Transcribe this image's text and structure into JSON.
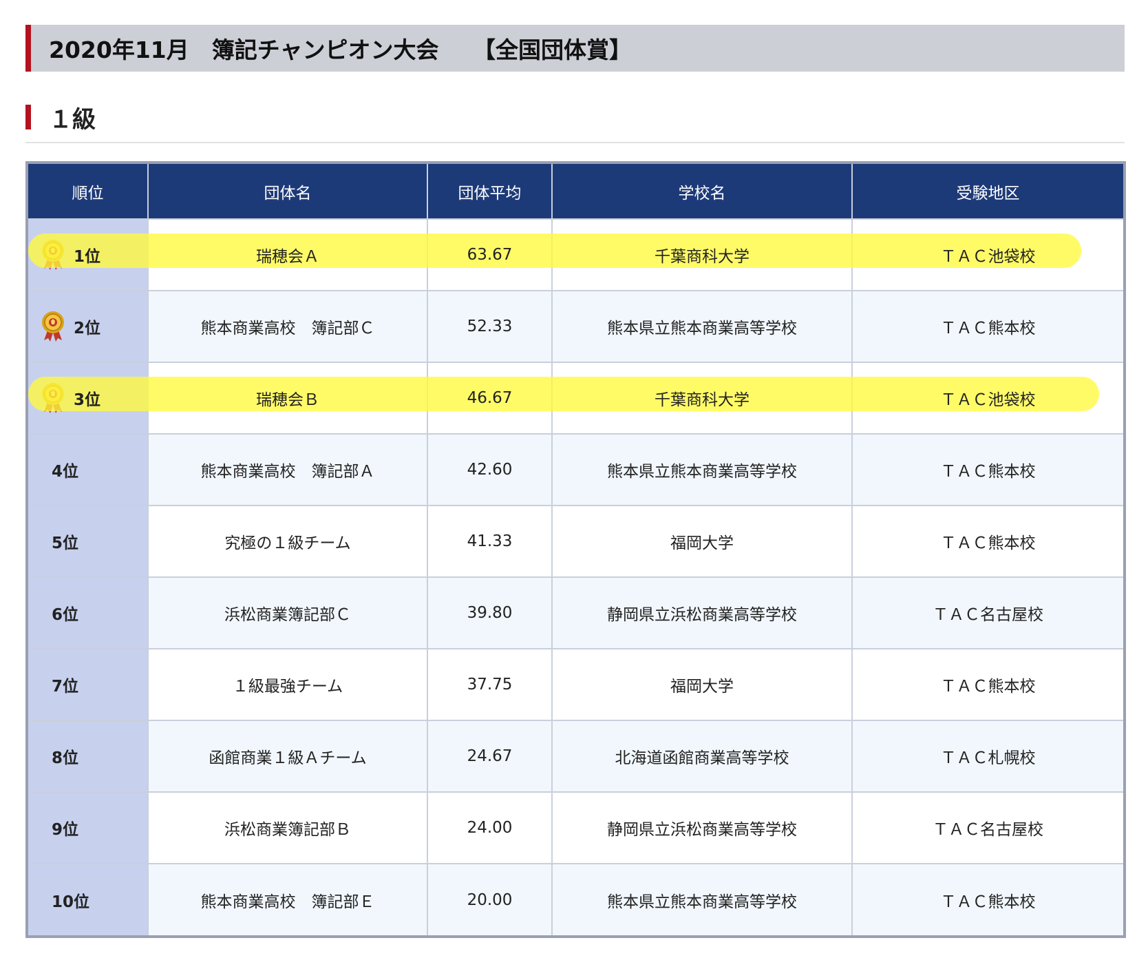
{
  "page": {
    "title": "2020年11月　簿記チャンピオン大会　　【全国団体賞】",
    "section_heading": "１級"
  },
  "colors": {
    "accent_red": "#b3121e",
    "header_navy": "#1d3a78",
    "rank_column": "#c7d1ee",
    "highlight_yellow": "#fffa3c"
  },
  "table": {
    "headers": [
      "順位",
      "団体名",
      "団体平均",
      "学校名",
      "受験地区"
    ],
    "rows": [
      {
        "rank": "1位",
        "team": "瑞穂会Ａ",
        "average": "63.67",
        "school": "千葉商科大学",
        "area": "ＴＡＣ池袋校",
        "medal": "gold-medal-icon",
        "highlighted": true
      },
      {
        "rank": "2位",
        "team": "熊本商業高校　簿記部Ｃ",
        "average": "52.33",
        "school": "熊本県立熊本商業高等学校",
        "area": "ＴＡＣ熊本校",
        "medal": "gold-medal-icon",
        "highlighted": false
      },
      {
        "rank": "3位",
        "team": "瑞穂会Ｂ",
        "average": "46.67",
        "school": "千葉商科大学",
        "area": "ＴＡＣ池袋校",
        "medal": "gold-medal-icon",
        "highlighted": true
      },
      {
        "rank": "4位",
        "team": "熊本商業高校　簿記部Ａ",
        "average": "42.60",
        "school": "熊本県立熊本商業高等学校",
        "area": "ＴＡＣ熊本校",
        "medal": null,
        "highlighted": false
      },
      {
        "rank": "5位",
        "team": "究極の１級チーム",
        "average": "41.33",
        "school": "福岡大学",
        "area": "ＴＡＣ熊本校",
        "medal": null,
        "highlighted": false
      },
      {
        "rank": "6位",
        "team": "浜松商業簿記部Ｃ",
        "average": "39.80",
        "school": "静岡県立浜松商業高等学校",
        "area": "ＴＡＣ名古屋校",
        "medal": null,
        "highlighted": false
      },
      {
        "rank": "7位",
        "team": "１級最強チーム",
        "average": "37.75",
        "school": "福岡大学",
        "area": "ＴＡＣ熊本校",
        "medal": null,
        "highlighted": false
      },
      {
        "rank": "8位",
        "team": "函館商業１級Ａチーム",
        "average": "24.67",
        "school": "北海道函館商業高等学校",
        "area": "ＴＡＣ札幌校",
        "medal": null,
        "highlighted": false
      },
      {
        "rank": "9位",
        "team": "浜松商業簿記部Ｂ",
        "average": "24.00",
        "school": "静岡県立浜松商業高等学校",
        "area": "ＴＡＣ名古屋校",
        "medal": null,
        "highlighted": false
      },
      {
        "rank": "10位",
        "team": "熊本商業高校　簿記部Ｅ",
        "average": "20.00",
        "school": "熊本県立熊本商業高等学校",
        "area": "ＴＡＣ熊本校",
        "medal": null,
        "highlighted": false
      }
    ]
  }
}
